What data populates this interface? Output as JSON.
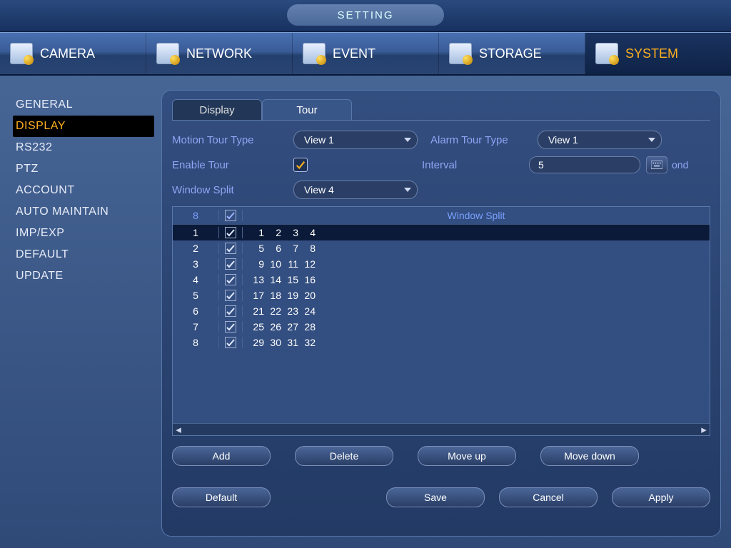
{
  "header": {
    "title": "SETTING"
  },
  "main_tabs": [
    {
      "label": "CAMERA"
    },
    {
      "label": "NETWORK"
    },
    {
      "label": "EVENT"
    },
    {
      "label": "STORAGE"
    },
    {
      "label": "SYSTEM"
    }
  ],
  "main_tab_active": 4,
  "sidebar": {
    "items": [
      "GENERAL",
      "DISPLAY",
      "RS232",
      "PTZ",
      "ACCOUNT",
      "AUTO MAINTAIN",
      "IMP/EXP",
      "DEFAULT",
      "UPDATE"
    ],
    "active": 1
  },
  "subtabs": {
    "items": [
      "Display",
      "Tour"
    ],
    "active": 1
  },
  "form": {
    "motion_tour_label": "Motion Tour Type",
    "motion_tour_value": "View 1",
    "alarm_tour_label": "Alarm Tour Type",
    "alarm_tour_value": "View 1",
    "enable_tour_label": "Enable Tour",
    "enable_tour_checked": true,
    "interval_label": "Interval",
    "interval_value": "5",
    "interval_unit_suffix": "ond",
    "window_split_label": "Window Split",
    "window_split_value": "View 4"
  },
  "grid": {
    "header": {
      "count": "8",
      "title": "Window Split"
    },
    "rows": [
      {
        "idx": "1",
        "checked": true,
        "cells": [
          "1",
          "2",
          "3",
          "4"
        ],
        "selected": true
      },
      {
        "idx": "2",
        "checked": true,
        "cells": [
          "5",
          "6",
          "7",
          "8"
        ]
      },
      {
        "idx": "3",
        "checked": true,
        "cells": [
          "9",
          "10",
          "11",
          "12"
        ]
      },
      {
        "idx": "4",
        "checked": true,
        "cells": [
          "13",
          "14",
          "15",
          "16"
        ]
      },
      {
        "idx": "5",
        "checked": true,
        "cells": [
          "17",
          "18",
          "19",
          "20"
        ]
      },
      {
        "idx": "6",
        "checked": true,
        "cells": [
          "21",
          "22",
          "23",
          "24"
        ]
      },
      {
        "idx": "7",
        "checked": true,
        "cells": [
          "25",
          "26",
          "27",
          "28"
        ]
      },
      {
        "idx": "8",
        "checked": true,
        "cells": [
          "29",
          "30",
          "31",
          "32"
        ]
      }
    ]
  },
  "buttons": {
    "add": "Add",
    "delete": "Delete",
    "moveup": "Move up",
    "movedown": "Move down",
    "default": "Default",
    "save": "Save",
    "cancel": "Cancel",
    "apply": "Apply"
  }
}
